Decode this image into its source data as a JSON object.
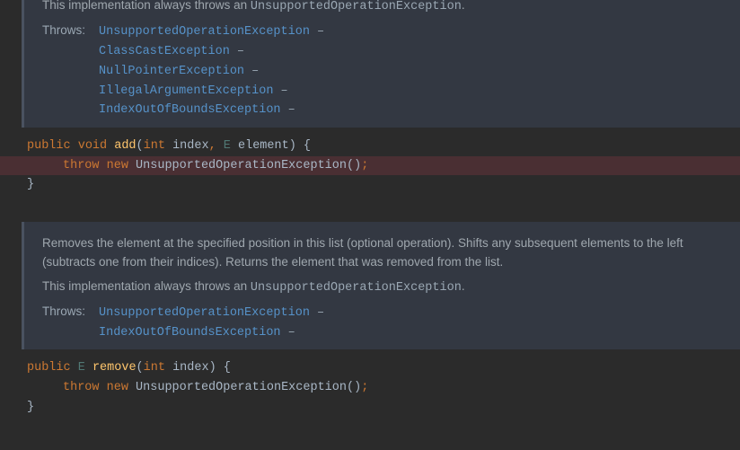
{
  "doc1": {
    "impl_text_prefix": "This implementation always throws an ",
    "impl_exception": "UnsupportedOperationException",
    "impl_text_suffix": ".",
    "throws_label": "Throws:",
    "throws": [
      "UnsupportedOperationException",
      "ClassCastException",
      "NullPointerException",
      "IllegalArgumentException",
      "IndexOutOfBoundsException"
    ],
    "dash": " –"
  },
  "code1": {
    "kw_public": "public",
    "kw_void": "void",
    "method": "add",
    "lparen": "(",
    "ptype": "int",
    "pname1": " index",
    "comma": ",",
    "type_param": " E",
    "pname2": " element",
    "rparen_brace": ") {",
    "kw_throw": "throw",
    "kw_new": "new",
    "exc": " UnsupportedOperationException()",
    "semi": ";",
    "close": "}"
  },
  "doc2": {
    "desc": "Removes the element at the specified position in this list (optional operation). Shifts any subsequent elements to the left (subtracts one from their indices). Returns the element that was removed from the list.",
    "impl_text_prefix": "This implementation always throws an ",
    "impl_exception": "UnsupportedOperationException",
    "impl_text_suffix": ".",
    "throws_label": "Throws:",
    "throws": [
      "UnsupportedOperationException",
      "IndexOutOfBoundsException"
    ],
    "dash": " –"
  },
  "code2": {
    "kw_public": "public",
    "type_param": "E",
    "method": "remove",
    "lparen": "(",
    "ptype": "int",
    "pname1": " index",
    "rparen_brace": ") {",
    "kw_throw": "throw",
    "kw_new": "new",
    "exc": " UnsupportedOperationException()",
    "semi": ";",
    "close": "}"
  }
}
